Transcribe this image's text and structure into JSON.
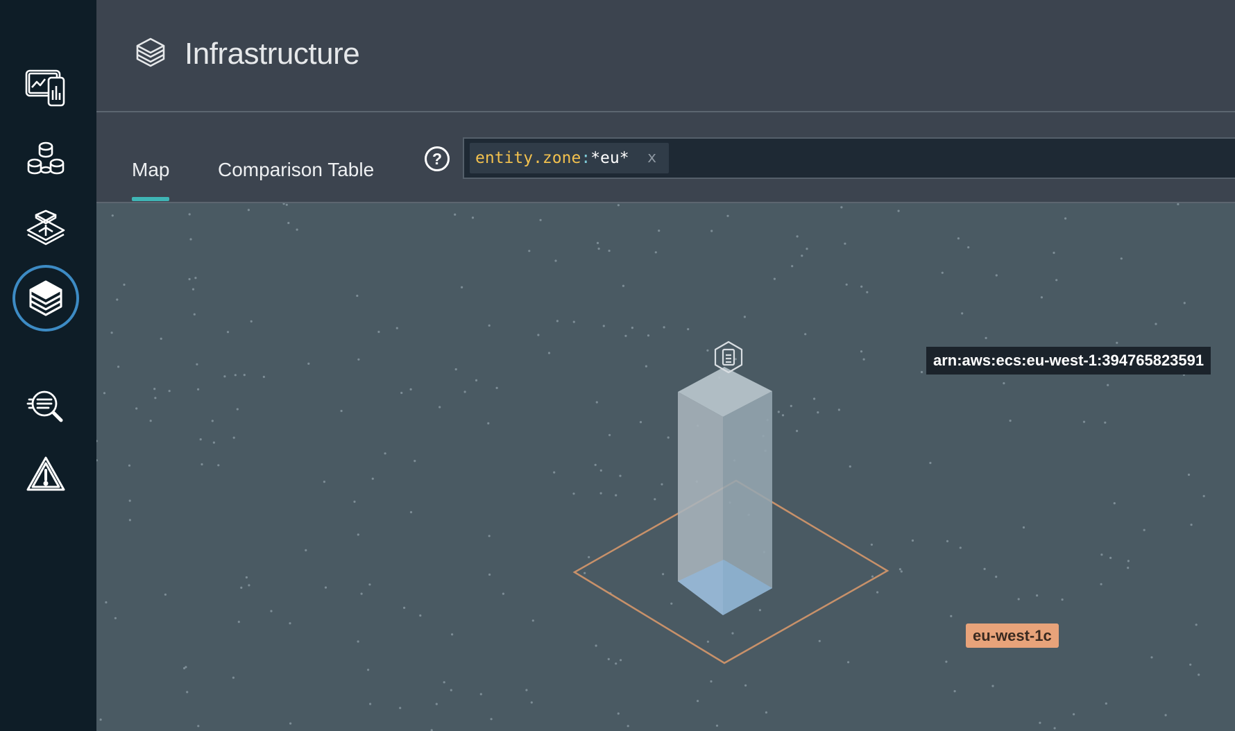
{
  "sidebar": {
    "items": [
      {
        "icon": "dashboard-devices-icon",
        "active": false
      },
      {
        "icon": "services-cluster-icon",
        "active": false
      },
      {
        "icon": "topology-icon",
        "active": false
      },
      {
        "icon": "infrastructure-layers-icon",
        "active": true
      },
      {
        "icon": "log-search-icon",
        "active": false
      },
      {
        "icon": "alert-warning-icon",
        "active": false
      }
    ]
  },
  "header": {
    "icon": "layers-icon",
    "title": "Infrastructure"
  },
  "tabs": [
    {
      "label": "Map",
      "active": true
    },
    {
      "label": "Comparison Table",
      "active": false
    }
  ],
  "search": {
    "help_icon": "question-circle-icon",
    "help_label": "?",
    "filter": {
      "key": "entity.zone",
      "separator": ":",
      "value": "*eu*",
      "remove_label": "x"
    }
  },
  "map": {
    "entity": {
      "icon": "ecs-task-icon",
      "label": "arn:aws:ecs:eu-west-1:394765823591"
    },
    "zone": {
      "label": "eu-west-1c",
      "color": "#e8a37a"
    }
  },
  "colors": {
    "sidebar": "#0e1d27",
    "header": "#3c444f",
    "map_background": "#4a5a63",
    "accent": "#3fb5b5",
    "active_ring": "#3d8bc4",
    "filter_key": "#f2c14e"
  }
}
